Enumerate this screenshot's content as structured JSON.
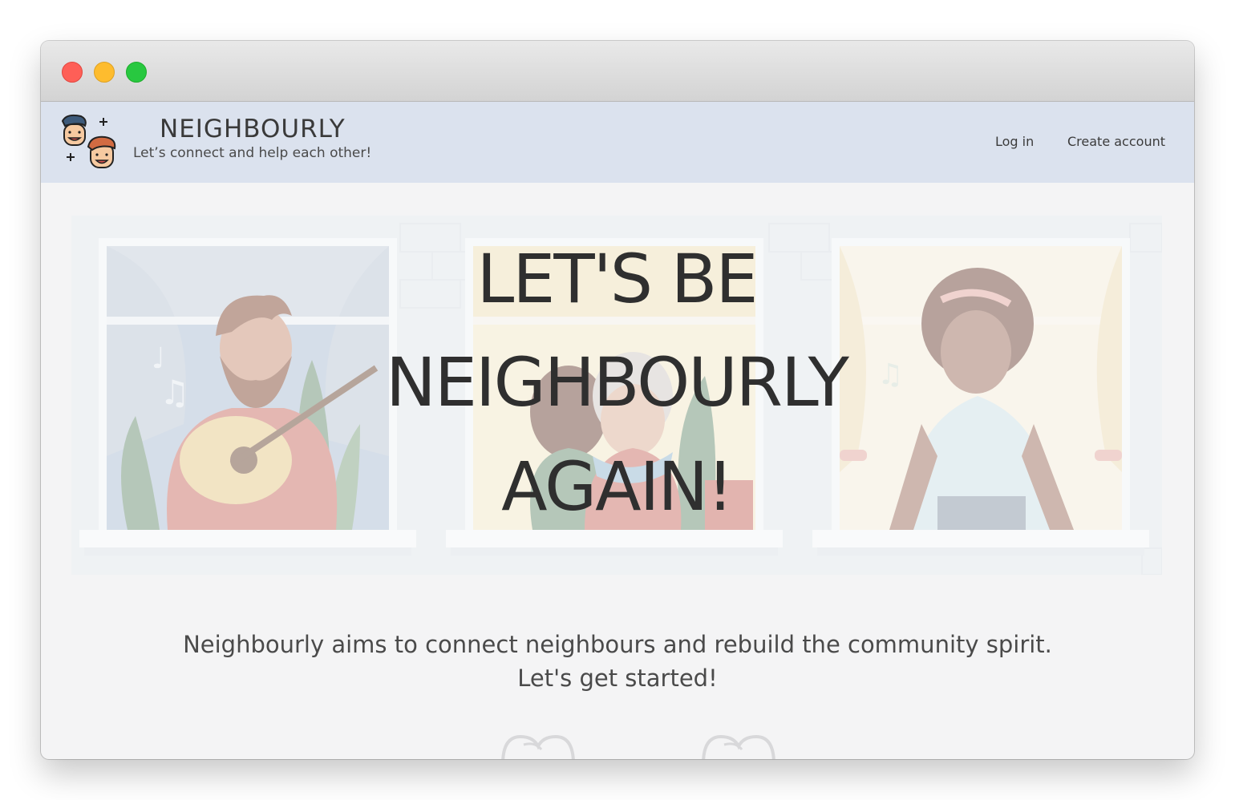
{
  "window": {
    "controls": {
      "close": "close-light",
      "minimize": "minimize-light",
      "zoom": "zoom-light",
      "colors": {
        "close": "#fe5f57",
        "minimize": "#febc2e",
        "zoom": "#28c840"
      }
    }
  },
  "header": {
    "brand": "NEIGHBOURLY",
    "tagline": "Let’s connect and help each other!",
    "logo_icon": "two-faces-icon",
    "nav": {
      "login_label": "Log in",
      "create_account_label": "Create account"
    },
    "background_color": "#dbe2ee"
  },
  "hero": {
    "line1": "LET'S BE",
    "line2": "NEIGHBOURLY",
    "line3": "AGAIN!",
    "illustration": "neighbours-in-windows-illustration"
  },
  "intro": {
    "line1": "Neighbourly aims to connect neighbours and rebuild the community spirit.",
    "line2": "Let's get started!"
  },
  "decorations": [
    "heart-outline-icon",
    "heart-outline-icon"
  ]
}
